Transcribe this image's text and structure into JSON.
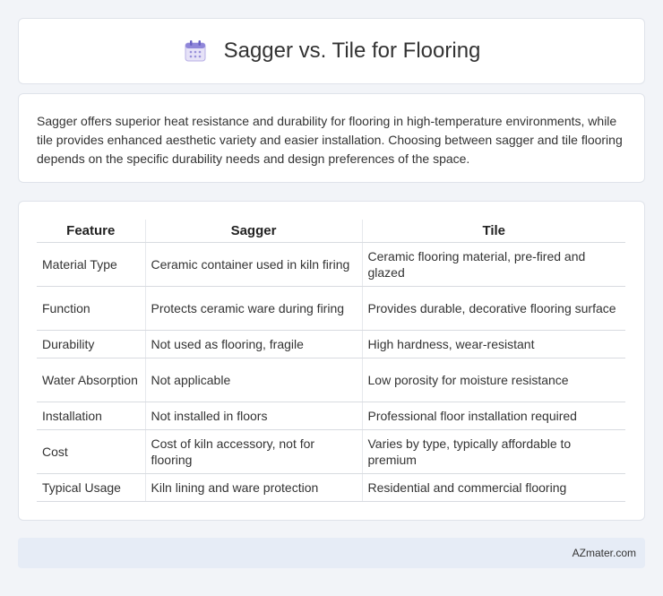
{
  "header": {
    "title": "Sagger vs. Tile for Flooring",
    "icon": "calendar-icon"
  },
  "summary": {
    "text": "Sagger offers superior heat resistance and durability for flooring in high-temperature environments, while tile provides enhanced aesthetic variety and easier installation. Choosing between sagger and tile flooring depends on the specific durability needs and design preferences of the space."
  },
  "table": {
    "headers": [
      "Feature",
      "Sagger",
      "Tile"
    ],
    "rows": [
      [
        "Material Type",
        "Ceramic container used in kiln firing",
        "Ceramic flooring material, pre-fired and glazed"
      ],
      [
        "Function",
        "Protects ceramic ware during firing",
        "Provides durable, decorative flooring surface"
      ],
      [
        "Durability",
        "Not used as flooring, fragile",
        "High hardness, wear-resistant"
      ],
      [
        "Water Absorption",
        "Not applicable",
        "Low porosity for moisture resistance"
      ],
      [
        "Installation",
        "Not installed in floors",
        "Professional floor installation required"
      ],
      [
        "Cost",
        "Cost of kiln accessory, not for flooring",
        "Varies by type, typically affordable to premium"
      ],
      [
        "Typical Usage",
        "Kiln lining and ware protection",
        "Residential and commercial flooring"
      ]
    ]
  },
  "footer": {
    "text": "AZmater.com"
  }
}
